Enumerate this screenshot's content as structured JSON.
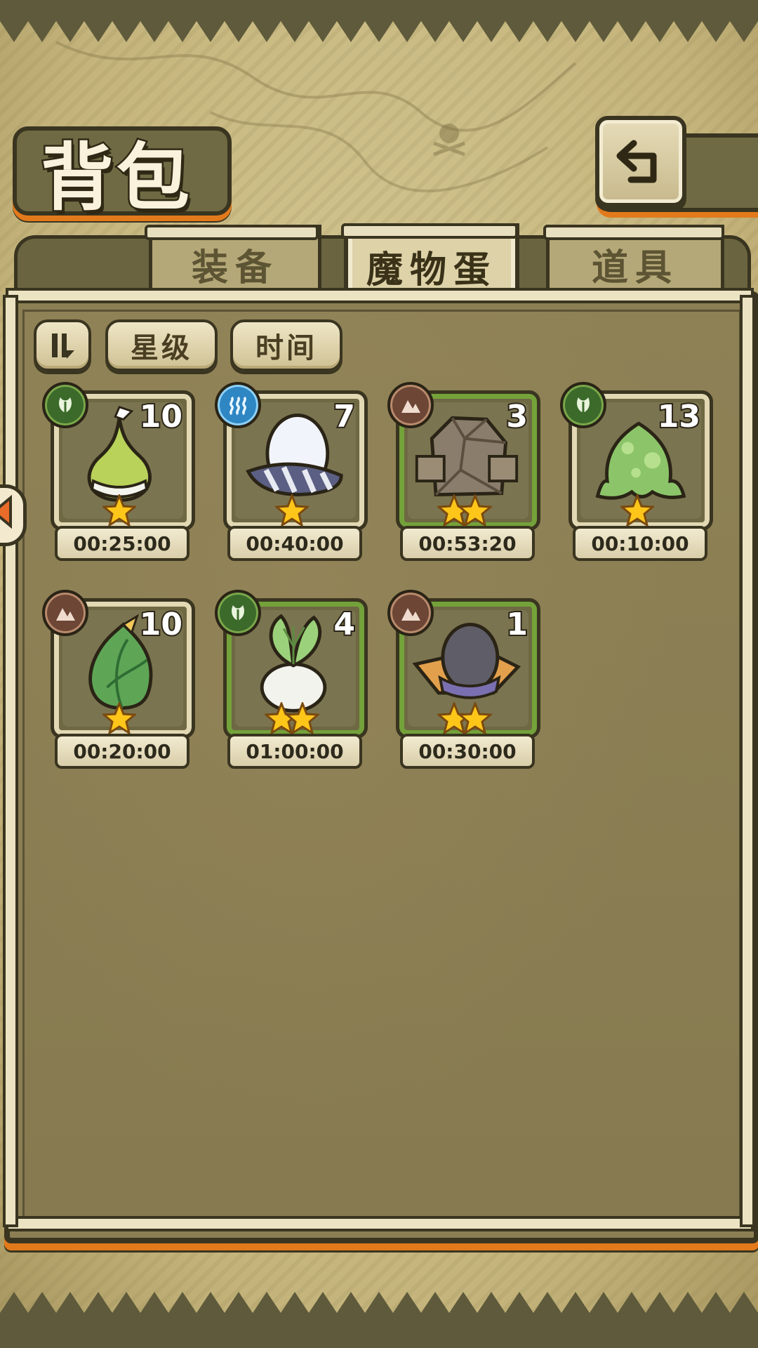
{
  "header": {
    "title": "背包"
  },
  "tabs": [
    {
      "label": "装备",
      "active": false
    },
    {
      "label": "魔物蛋",
      "active": true
    },
    {
      "label": "道具",
      "active": false
    }
  ],
  "filters": {
    "toggle_icon": "sort-toggle-icon",
    "star_label": "星级",
    "time_label": "时间"
  },
  "items": [
    {
      "count": "10",
      "time": "00:25:00",
      "element": "nature",
      "stars": 1,
      "monster": "green-bulb-egg"
    },
    {
      "count": "7",
      "time": "00:40:00",
      "element": "water",
      "stars": 1,
      "monster": "white-striped-egg"
    },
    {
      "count": "3",
      "time": "00:53:20",
      "element": "earth",
      "stars": 2,
      "monster": "rock-golem-egg"
    },
    {
      "count": "13",
      "time": "00:10:00",
      "element": "nature",
      "stars": 1,
      "monster": "slime-egg"
    },
    {
      "count": "10",
      "time": "00:20:00",
      "element": "earth",
      "stars": 1,
      "monster": "leaf-bud-egg"
    },
    {
      "count": "4",
      "time": "01:00:00",
      "element": "nature",
      "stars": 2,
      "monster": "radish-egg"
    },
    {
      "count": "1",
      "time": "00:30:00",
      "element": "earth",
      "stars": 2,
      "monster": "hat-egg"
    }
  ],
  "colors": {
    "accent_orange": "#e27a1c",
    "frame_dark": "#3a3520",
    "panel_brown": "#8c7f54",
    "rare_frame_green": "#74a23a"
  }
}
